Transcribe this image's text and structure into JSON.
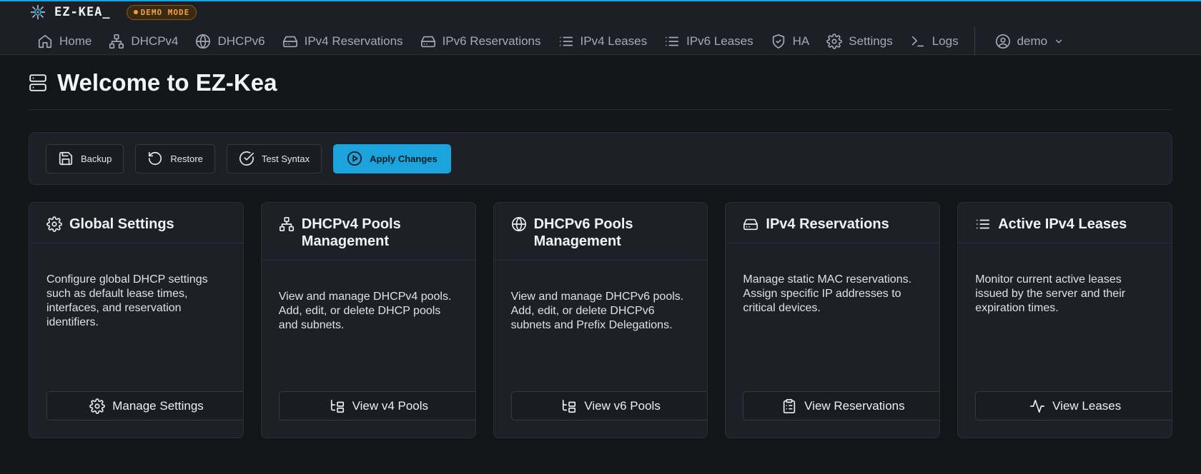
{
  "brand": {
    "name": "EZ-KEA_",
    "badge": "DEMO MODE"
  },
  "nav": {
    "items": [
      {
        "label": "Home",
        "icon": "home-icon"
      },
      {
        "label": "DHCPv4",
        "icon": "network-icon"
      },
      {
        "label": "DHCPv6",
        "icon": "globe-icon"
      },
      {
        "label": "IPv4 Reservations",
        "icon": "hard-drive-icon"
      },
      {
        "label": "IPv6 Reservations",
        "icon": "hard-drive-icon"
      },
      {
        "label": "IPv4 Leases",
        "icon": "list-icon"
      },
      {
        "label": "IPv6 Leases",
        "icon": "list-icon"
      },
      {
        "label": "HA",
        "icon": "shield-check-icon"
      },
      {
        "label": "Settings",
        "icon": "gear-icon"
      },
      {
        "label": "Logs",
        "icon": "terminal-icon"
      }
    ],
    "user": "demo"
  },
  "page": {
    "title": "Welcome to EZ-Kea"
  },
  "toolbar": {
    "backup": "Backup",
    "restore": "Restore",
    "test_syntax": "Test Syntax",
    "apply": "Apply Changes"
  },
  "cards": [
    {
      "title": "Global Settings",
      "description": "Configure global DHCP settings such as default lease times, interfaces, and reservation identifiers.",
      "button": "Manage Settings"
    },
    {
      "title": "DHCPv4 Pools Management",
      "description": "View and manage DHCPv4 pools. Add, edit, or delete DHCP pools and subnets.",
      "button": "View v4 Pools"
    },
    {
      "title": "DHCPv6 Pools Management",
      "description": "View and manage DHCPv6 pools. Add, edit, or delete DHCPv6 subnets and Prefix Delegations.",
      "button": "View v6 Pools"
    },
    {
      "title": "IPv4 Reservations",
      "description": "Manage static MAC reservations. Assign specific IP addresses to critical devices.",
      "button": "View Reservations"
    },
    {
      "title": "Active IPv4 Leases",
      "description": "Monitor current active leases issued by the server and their expiration times.",
      "button": "View Leases"
    }
  ],
  "colors": {
    "accent": "#1aa3dc",
    "badge": "#f0a23a",
    "background": "#141519",
    "panel": "#1e2028"
  }
}
